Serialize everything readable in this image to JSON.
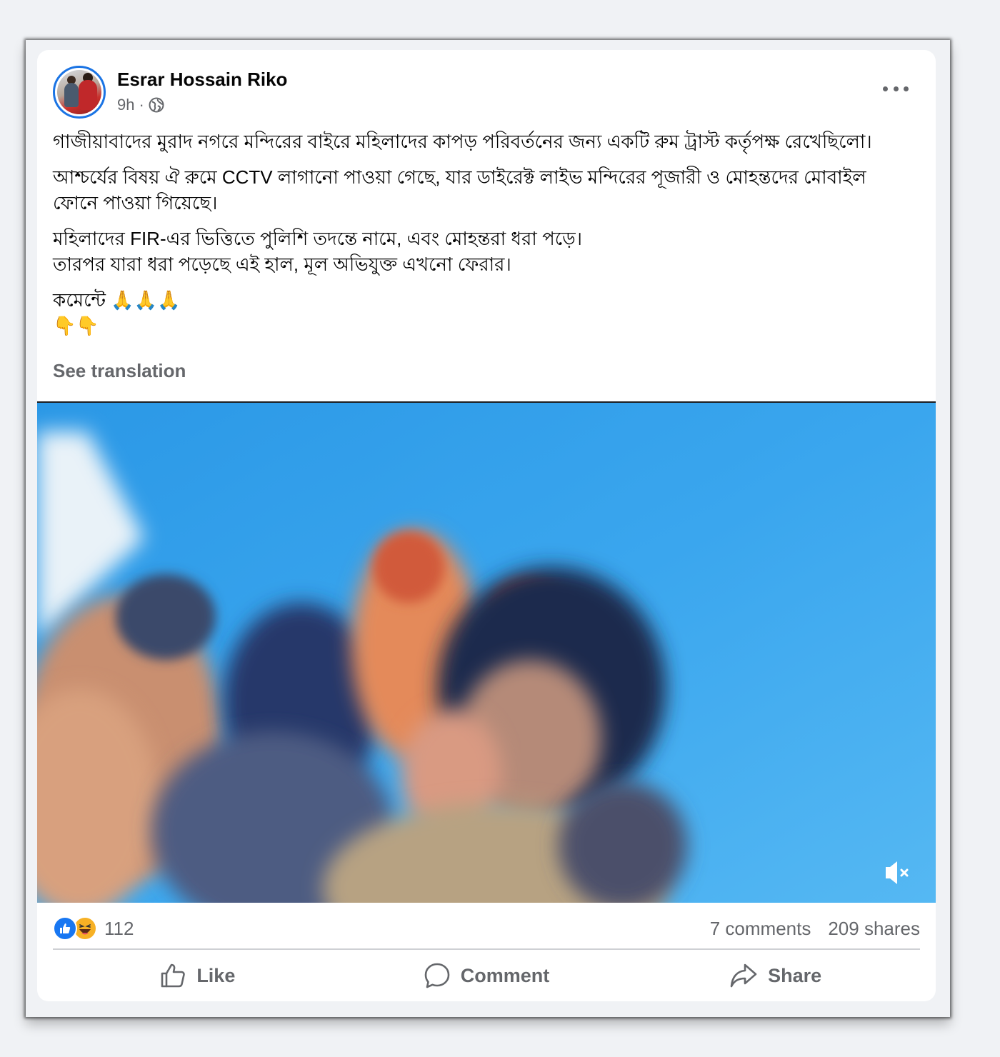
{
  "post": {
    "author": "Esrar Hossain Riko",
    "time": "9h",
    "separator": "·",
    "visibility_icon": "globe-icon",
    "more_icon": "more-options-icon",
    "paragraphs": [
      "গাজীয়াবাদের মুরাদ নগরে মন্দিরের বাইরে মহিলাদের কাপড় পরিবর্তনের জন্য একটি রুম ট্রাস্ট কর্তৃপক্ষ রেখেছিলো।",
      "আশ্চর্যের বিষয় ঐ রুমে CCTV লাগানো পাওয়া গেছে, যার ডাইরেক্ট লাইভ মন্দিরের পূজারী ও মোহন্তদের মোবাইল ফোনে পাওয়া গিয়েছে।",
      "মহিলাদের FIR-এর ভিত্তিতে পুলিশি তদন্তে নামে, এবং মোহন্তরা ধরা পড়ে।",
      "তারপর যারা ধরা পড়েছে এই হাল, মূল অভিযুক্ত এখনো ফেরার।",
      "কমেন্টে 🙏🙏🙏",
      "👇👇"
    ],
    "see_translation": "See translation"
  },
  "video": {
    "mute_icon": "muted-speaker-icon"
  },
  "stats": {
    "reaction_icons": [
      "like-reaction-icon",
      "haha-reaction-icon"
    ],
    "reaction_count": "112",
    "comments": "7 comments",
    "shares": "209 shares"
  },
  "actions": {
    "like": "Like",
    "comment": "Comment",
    "share": "Share"
  },
  "colors": {
    "page_bg": "#f0f2f5",
    "card_bg": "#ffffff",
    "text_primary": "#050505",
    "text_secondary": "#65676b",
    "accent": "#1877f2"
  }
}
